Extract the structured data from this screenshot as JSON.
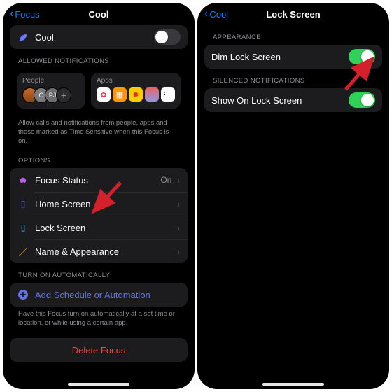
{
  "left": {
    "back": "Focus",
    "title": "Cool",
    "modeToggle": {
      "label": "Cool",
      "on": false
    },
    "allowedHeader": "ALLOWED NOTIFICATIONS",
    "peopleTile": "People",
    "appsTile": "Apps",
    "allowedFooter": "Allow calls and notifications from people, apps and those marked as Time Sensitive when this Focus is on.",
    "optionsHeader": "OPTIONS",
    "options": [
      {
        "label": "Focus Status",
        "value": "On"
      },
      {
        "label": "Home Screen",
        "value": ""
      },
      {
        "label": "Lock Screen",
        "value": ""
      },
      {
        "label": "Name & Appearance",
        "value": ""
      }
    ],
    "autoHeader": "TURN ON AUTOMATICALLY",
    "addSchedule": "Add Schedule or Automation",
    "autoFooter": "Have this Focus turn on automatically at a set time or location, or while using a certain app.",
    "delete": "Delete Focus"
  },
  "right": {
    "back": "Cool",
    "title": "Lock Screen",
    "appearanceHeader": "APPEARANCE",
    "dimRow": {
      "label": "Dim Lock Screen",
      "on": true
    },
    "silencedHeader": "SILENCED NOTIFICATIONS",
    "showRow": {
      "label": "Show On Lock Screen",
      "on": true
    }
  }
}
